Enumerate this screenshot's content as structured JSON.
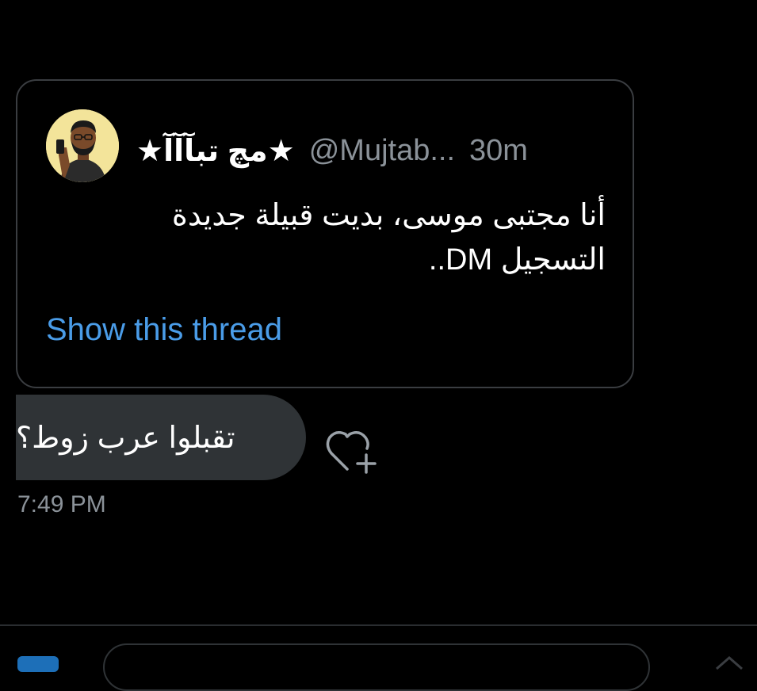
{
  "quoted_tweet": {
    "author_name": "★مچ تبآآآ★",
    "author_handle": "@Mujtab...",
    "time_ago": "30m",
    "text_line1": "أنا مجتبى موسى، بديت قبيلة جديدة",
    "text_line2": "التسجيل DM..",
    "show_thread_label": "Show this thread",
    "avatar_icon": "person-selfie-avatar"
  },
  "message": {
    "text": "تقبلوا عرب زوط؟",
    "timestamp": "7:49 PM",
    "react_icon": "heart-plus-icon"
  },
  "colors": {
    "background": "#000000",
    "card_border": "#3a3d41",
    "bubble": "#2f3336",
    "link": "#4a9ce8",
    "muted": "#8b9299"
  }
}
